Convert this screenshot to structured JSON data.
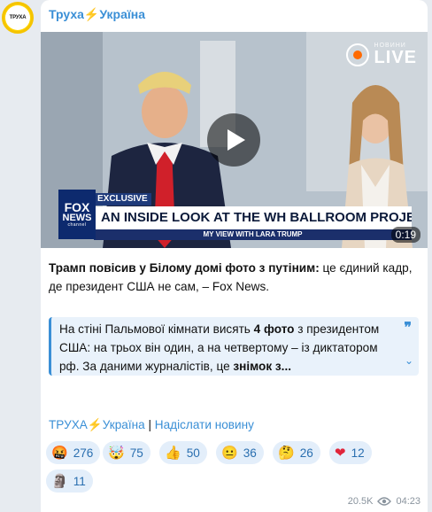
{
  "channel": {
    "avatar_text": "ТРУХА",
    "name": "Труха⚡Україна"
  },
  "video": {
    "live_logo_small": "НОВИНИ",
    "live_logo_big": "LIVE",
    "exclusive_label": "EXCLUSIVE",
    "headline": "AN INSIDE LOOK AT THE WH BALLROOM PROJECT",
    "subline": "MY VIEW WITH LARA TRUMP",
    "fox_logo_1": "FOX",
    "fox_logo_2": "NEWS",
    "fox_logo_3": "channel",
    "duration": "0:19"
  },
  "post": {
    "bold": "Трамп повісив у Білому домі фото з путіним:",
    "rest": " це єдиний кадр, де президент США не сам, – Fox News."
  },
  "quote": {
    "part1": "На стіні Пальмової кімнати висять ",
    "bold1": "4 фото",
    "part2": " з президентом США: на трьох він один, а на четвертому – із диктатором рф. За даними журналістів, це ",
    "bold2": "знімок з...",
    "mark": "❞",
    "expand": "⌄"
  },
  "footer": {
    "channel_link": "ТРУХА⚡Україна",
    "separator": " | ",
    "submit_link": "Надіслати новину"
  },
  "reactions": [
    {
      "emoji": "🤬",
      "count": "276"
    },
    {
      "emoji": "🤯",
      "count": "75"
    },
    {
      "emoji": "👍",
      "count": "50"
    },
    {
      "emoji": "😐",
      "count": "36"
    },
    {
      "emoji": "🤔",
      "count": "26"
    },
    {
      "emoji": "❤",
      "count": "12"
    },
    {
      "emoji": "🗿",
      "count": "11"
    }
  ],
  "meta": {
    "views": "20.5K",
    "views_icon": "eye-icon",
    "time": "04:23"
  }
}
